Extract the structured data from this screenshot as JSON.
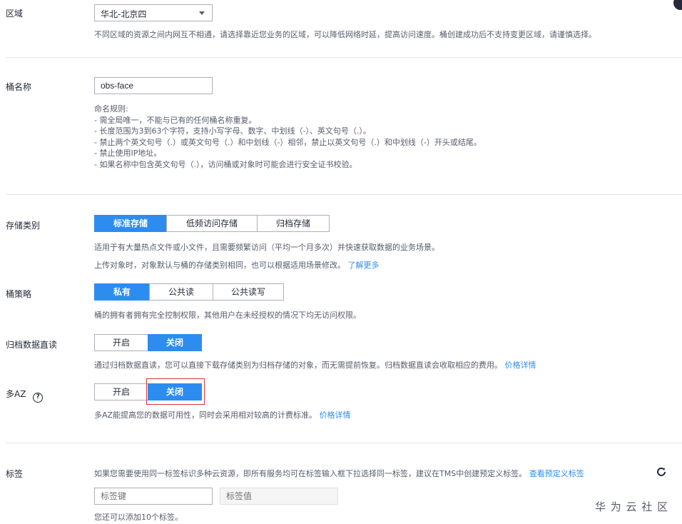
{
  "region": {
    "label": "区域",
    "value": "华北-北京四",
    "hint": "不同区域的资源之间内网互不相通，请选择靠近您业务的区域，可以降低网络时延，提高访问速度。桶创建成功后不支持变更区域，请谨慎选择。"
  },
  "bucket_name": {
    "label": "桶名称",
    "value": "obs-face",
    "rules": [
      "命名规则:",
      "- 需全局唯一，不能与已有的任何桶名称重复。",
      "- 长度范围为3到63个字符，支持小写字母、数字、中划线（-）、英文句号（.）。",
      "- 禁止两个英文句号（.）或英文句号（.）和中划线（-）相邻，禁止以英文句号（.）和中划线（-）开头或结尾。",
      "- 禁止使用IP地址。",
      "- 如果名称中包含英文句号（.），访问桶或对象时可能会进行安全证书校验。"
    ]
  },
  "storage_class": {
    "label": "存储类别",
    "options": [
      "标准存储",
      "低频访问存储",
      "归档存储"
    ],
    "selected": 0,
    "hint1": "适用于有大量热点文件或小文件，且需要频繁访问（平均一个月多次）并快速获取数据的业务场景。",
    "hint2": "上传对象时，对象默认与桶的存储类别相同，也可以根据适用场景修改。",
    "learn_more": "了解更多"
  },
  "bucket_policy": {
    "label": "桶策略",
    "options": [
      "私有",
      "公共读",
      "公共读写"
    ],
    "selected": 0,
    "hint": "桶的拥有者拥有完全控制权限，其他用户在未经授权的情况下均无访问权限。"
  },
  "archive_direct_read": {
    "label": "归档数据直读",
    "options": [
      "开启",
      "关闭"
    ],
    "selected": 1,
    "hint": "通过归档数据直读，您可以直接下载存储类别为归档存储的对象，而无需提前恢复。归档数据直读会收取相应的费用。",
    "price_link": "价格详情"
  },
  "multi_az": {
    "label": "多AZ",
    "help_glyph": "?",
    "options": [
      "开启",
      "关闭"
    ],
    "selected": 1,
    "hint": "多AZ能提高您的数据可用性，同时会采用相对较高的计费标准。",
    "price_link": "价格详情"
  },
  "tags": {
    "label": "标签",
    "hint": "如果您需要使用同一标签标识多种云资源，即所有服务均可在标签输入框下拉选择同一标签，建议在TMS中创建预定义标签。",
    "view_link": "查看预定义标签",
    "key_placeholder": "标签键",
    "value_placeholder": "标签值",
    "remaining": "您还可以添加10个标签。"
  },
  "watermark": "华 为 云 社 区",
  "colors": {
    "accent": "#2d8cf0",
    "highlight": "#e03131"
  }
}
